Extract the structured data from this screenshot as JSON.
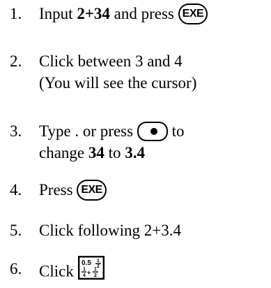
{
  "steps": [
    {
      "number": "1.",
      "line1_a": "Input ",
      "line1_b": "2+34",
      "line1_c": " and press",
      "button": "EXE"
    },
    {
      "number": "2.",
      "line1": "Click between 3 and 4",
      "line2": "(You will see the cursor)"
    },
    {
      "number": "3.",
      "line1_a": "Type . or press",
      "line1_b": " to",
      "line2_a": "change ",
      "line2_b": "34",
      "line2_c": " to ",
      "line2_d": "3.4",
      "button_icon": "decimal-point-key-icon"
    },
    {
      "number": "4.",
      "line1": "Press",
      "button": "EXE"
    },
    {
      "number": "5.",
      "line1": "Click following 2+3.4"
    },
    {
      "number": "6.",
      "line1": "Click",
      "button_icon": "fraction-decimal-toggle-icon"
    }
  ]
}
